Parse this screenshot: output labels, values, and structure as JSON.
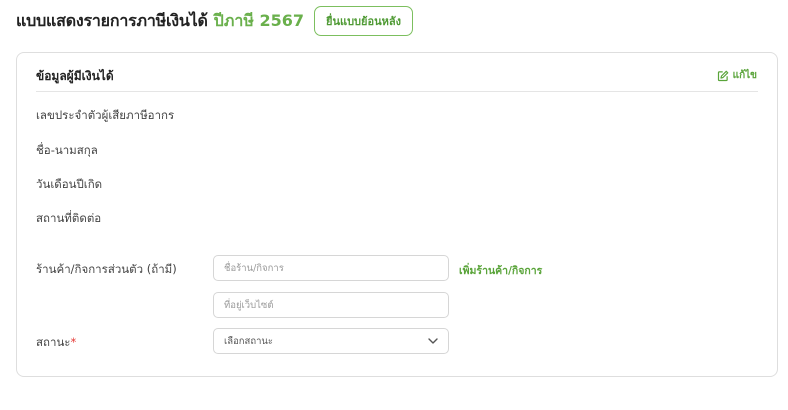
{
  "header": {
    "title": "แบบแสดงรายการภาษีเงินได้",
    "tax_year": "ปีภาษี 2567",
    "file_back_button": "ยื่นแบบย้อนหลัง"
  },
  "card": {
    "title": "ข้อมูลผู้มีเงินได้",
    "edit_label": "แก้ไข",
    "fields": {
      "tax_id": "เลขประจำตัวผู้เสียภาษีอากร",
      "name": "ชื่อ-นามสกุล",
      "birth_date": "วันเดือนปีเกิด",
      "address": "สถานที่ติดต่อ",
      "shop": "ร้านค้า/กิจการส่วนตัว (ถ้ามี)",
      "status": "สถานะ",
      "status_required": "*"
    },
    "shop_name_placeholder": "ชื่อร้าน/กิจการ",
    "website_placeholder": "ที่อยู่เว็บไซต์",
    "add_shop_link": "เพิ่มร้านค้า/กิจการ",
    "status_select": "เลือกสถานะ"
  },
  "colors": {
    "accent_green": "#6ab04c",
    "link_green": "#5aa43a",
    "required_red": "#e53935"
  },
  "icons": {
    "edit": "edit-icon",
    "dropdown": "chevron-down-icon"
  }
}
